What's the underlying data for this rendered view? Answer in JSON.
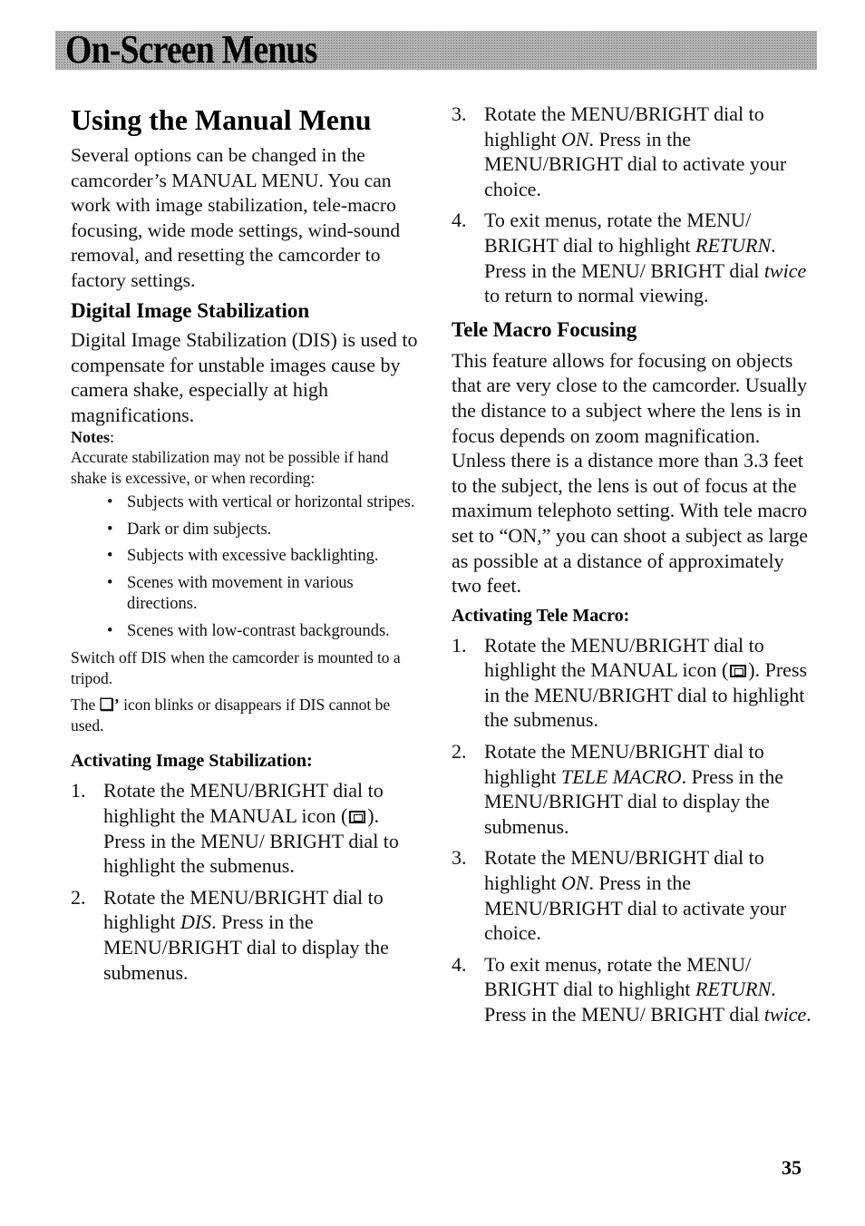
{
  "header": {
    "section_title": "On-Screen Menus"
  },
  "left": {
    "title": "Using the Manual Menu",
    "intro": "Several options can be changed in the camcorder’s MANUAL MENU. You can work with image stabilization, tele-macro focusing, wide mode settings, wind-sound removal, and resetting the camcorder to factory settings.",
    "dis_heading": "Digital Image Stabilization",
    "dis_text": "Digital Image Stabilization (DIS) is used to compensate for unstable images cause by camera shake, especially at high magnifications.",
    "notes_label": "Notes",
    "notes_colon": ":",
    "notes_text": "Accurate stabilization may not be possible if hand shake is excessive, or when recording:",
    "bullets": [
      "Subjects with vertical or horizontal stripes.",
      "Dark or dim subjects.",
      "Subjects with excessive backlighting.",
      "Scenes with movement in various directions.",
      "Scenes with low-contrast backgrounds."
    ],
    "tripod_note": "Switch off DIS when the camcorder is mounted to a tripod.",
    "icon_note_pre": "The",
    "icon_note_post": "icon blinks or disappears if DIS cannot be used.",
    "activating_heading": "Activating Image Stabilization:",
    "steps": [
      {
        "num": "1.",
        "pre": "Rotate the MENU/BRIGHT dial to highlight the MANUAL icon (",
        "post": "). Press in the MENU/ BRIGHT dial to highlight the submenus."
      },
      {
        "num": "2.",
        "pre": "Rotate the MENU/BRIGHT dial to highlight ",
        "em": "DIS",
        "post": ". Press in the MENU/BRIGHT dial to display the submenus."
      }
    ]
  },
  "right": {
    "dis_steps": [
      {
        "num": "3.",
        "pre": "Rotate the MENU/BRIGHT dial to highlight ",
        "em": "ON",
        "post": ". Press in the MENU/BRIGHT dial to activate your choice."
      },
      {
        "num": "4.",
        "pre": "To exit menus, rotate the MENU/ BRIGHT dial to highlight ",
        "em": "RETURN",
        "mid": ". Press in the MENU/ BRIGHT dial ",
        "em2": "twice",
        "post": " to return to normal viewing."
      }
    ],
    "tele_heading": "Tele Macro Focusing",
    "tele_text": "This feature allows for focusing on objects that are very close to the camcorder. Usually the distance to a subject where the lens is in focus depends on zoom magnification. Unless there is a distance more than 3.3 feet to the subject, the lens is out of focus at the maximum telephoto setting. With tele macro set to “ON,” you can shoot a subject as large as possible at a distance of approximately two feet.",
    "activating_heading": "Activating Tele Macro:",
    "tele_steps": [
      {
        "num": "1.",
        "pre": "Rotate the MENU/BRIGHT dial to highlight the MANUAL icon (",
        "post": "). Press in the MENU/BRIGHT dial to highlight the submenus."
      },
      {
        "num": "2.",
        "pre": "Rotate the MENU/BRIGHT dial to highlight ",
        "em": "TELE MACRO",
        "post": ". Press in the MENU/BRIGHT dial to display the submenus."
      },
      {
        "num": "3.",
        "pre": "Rotate the MENU/BRIGHT dial to highlight ",
        "em": "ON",
        "post": ". Press in the MENU/BRIGHT dial to activate your choice."
      },
      {
        "num": "4.",
        "pre": "To exit menus, rotate the MENU/ BRIGHT dial to highlight ",
        "em": "RETURN",
        "mid": ". Press in the MENU/ BRIGHT dial ",
        "em2": "twice",
        "post": "."
      }
    ]
  },
  "footer": {
    "page_number": "35"
  },
  "icons": {
    "manual_icon": "manual-menu-icon",
    "dis_icon": "dis-hand-icon",
    "dis_glyph": "❏’"
  }
}
